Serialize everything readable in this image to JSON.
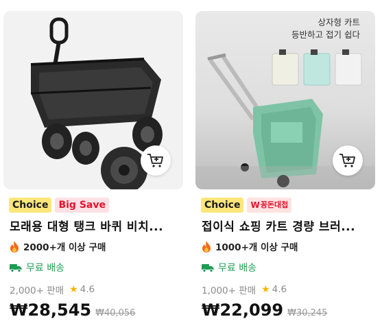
{
  "products": [
    {
      "badges": [
        "Choice",
        "Big Save"
      ],
      "title": "모래용 대형 탱크 바퀴 비치...",
      "purchase_text": "2000+개 이상 구매",
      "shipping": "무료 배송",
      "sold": "2,000+ 판매",
      "rating": "4.6",
      "price": "₩28,545",
      "original_price": "₩40,056"
    },
    {
      "badges": [
        "Choice",
        "꽁돈대첩"
      ],
      "sale_badge_mark": "W",
      "title": "접이식 쇼핑 카트 경량 브러...",
      "purchase_text": "1000+개 이상 구매",
      "shipping": "무료 배송",
      "sold": "1,000+ 판매",
      "rating": "4.6",
      "price": "₩22,099",
      "original_price": "₩30,245",
      "image_overlay": [
        "상자형 카트",
        "등반하고 접기 쉽다"
      ]
    }
  ],
  "colors": {
    "choice_badge": "#fde67a",
    "sale_badge_text": "#e3122d",
    "shipping_green": "#1e9c55",
    "rating_star": "#f5b400"
  },
  "icons": [
    "flame-icon",
    "truck-icon",
    "star-icon",
    "add-to-cart-icon"
  ]
}
